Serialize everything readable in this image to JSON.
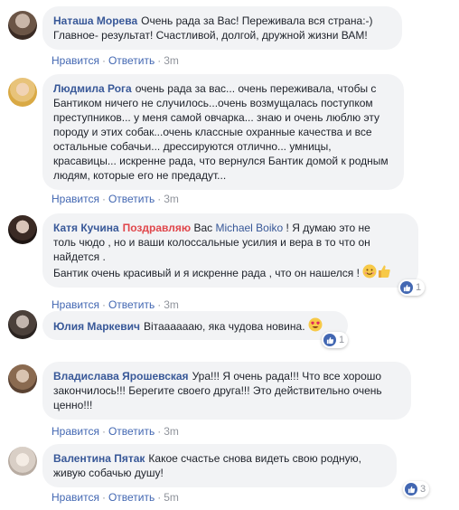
{
  "meta": {
    "like_label": "Нравится",
    "reply_label": "Ответить",
    "separator": "·"
  },
  "colors": {
    "link": "#385898",
    "bubble_bg": "#f2f3f5",
    "meta_text": "#90949c",
    "like_blue": "#4267b2",
    "congrats_red": "#e0464b"
  },
  "comments": [
    {
      "author": "Наташа Морева",
      "lines": [
        "Очень рада за Вас! Переживала вся страна:-)",
        "Главное- результат! Счастливой, долгой, дружной жизни ВАМ!"
      ],
      "time": "3m"
    },
    {
      "author": "Людмила Рога",
      "lines": [
        "очень рада за вас... очень переживала, чтобы с",
        "Бантиком ничего не случилось...очень возмущалась поступком",
        "преступников... у меня самой овчарка... знаю и очень люблю эту",
        "породу и этих собак...очень классные охранные качества и все",
        "остальные собачьи... дрессируются отлично... умницы,",
        "красавицы... искренне рада, что вернулся Бантик домой к родным",
        "людям, которые его не предадут..."
      ],
      "time": "3m"
    },
    {
      "author": "Катя Кучина",
      "highlight": "Поздравляю",
      "line1_rest": "Вас",
      "mention": "Michael Boiko",
      "line1_end": "! Я думаю это не",
      "lines": [
        "толь чюдо , но и ваши колоссальные усилия и вера в то что он",
        "найдется .",
        "Бантик очень красивый и я искренне рада , что он нашелся !"
      ],
      "time": "3m",
      "reactions": "1",
      "emoji_icons": [
        "smiling-face-icon",
        "thumbs-up-icon"
      ]
    },
    {
      "author": "Юлия Маркевич",
      "text": "Вітааааааю, яка чудова новина.",
      "time": "3m",
      "reactions": "1",
      "emoji_icons": [
        "heart-eyes-icon"
      ]
    },
    {
      "author": "Владислава Ярошевская",
      "lines_first": "Ура!!! Я очень рада!!! Что все хорошо",
      "lines": [
        "закончилось!!! Берегите своего друга!!! Это действительно очень",
        "ценно!!!"
      ],
      "time": "3m"
    },
    {
      "author": "Валентина Пятак",
      "lines_first": "Какое счастье снова видеть свою родную,",
      "lines": [
        "живую собачью душу!"
      ],
      "time": "5m",
      "reactions": "3"
    }
  ]
}
